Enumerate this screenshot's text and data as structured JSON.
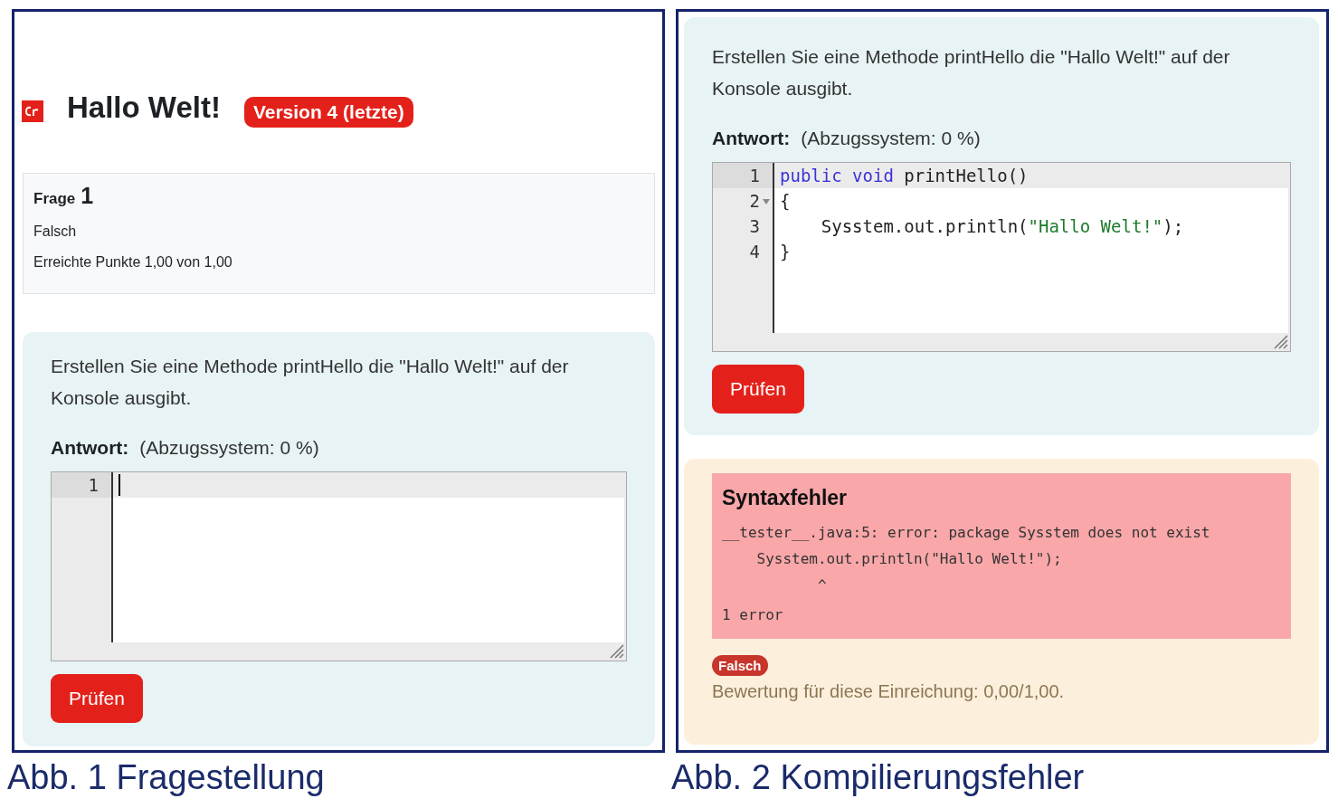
{
  "figure_1": {
    "header": {
      "title": "Hallo Welt!",
      "badge": "Version 4 (letzte)"
    },
    "info": {
      "label": "Frage",
      "number": "1",
      "status": "Falsch",
      "points": "Erreichte Punkte 1,00 von 1,00"
    },
    "question": {
      "text": "Erstellen Sie eine Methode printHello die \"Hallo Welt!\" auf der Konsole ausgibt.",
      "answer_label": "Antwort:",
      "answer_note": "(Abzugssystem: 0 %)",
      "editor": {
        "lines": [
          {
            "number": "1",
            "active": true,
            "foldable": false,
            "cursor": true
          }
        ]
      },
      "button": "Prüfen"
    },
    "caption": "Abb. 1 Fragestellung"
  },
  "figure_2": {
    "question": {
      "text": "Erstellen Sie eine Methode printHello die \"Hallo Welt!\" auf der Konsole ausgibt.",
      "answer_label": "Antwort:",
      "answer_note": "(Abzugssystem: 0 %)",
      "editor": {
        "lines": [
          {
            "number": "1",
            "active": true,
            "foldable": false,
            "cursor": false,
            "tokens": [
              {
                "kind": "keyword",
                "text": "public "
              },
              {
                "kind": "keyword",
                "text": "void"
              },
              {
                "kind": "plain",
                "text": " printHello()"
              }
            ]
          },
          {
            "number": "2",
            "active": false,
            "foldable": true,
            "cursor": false,
            "tokens": [
              {
                "kind": "plain",
                "text": "{"
              }
            ]
          },
          {
            "number": "3",
            "active": false,
            "foldable": false,
            "cursor": false,
            "tokens": [
              {
                "kind": "plain",
                "text": "    Sysstem.out.println("
              },
              {
                "kind": "string",
                "text": "\"Hallo Welt!\""
              },
              {
                "kind": "plain",
                "text": ");"
              }
            ]
          },
          {
            "number": "4",
            "active": false,
            "foldable": false,
            "cursor": false,
            "tokens": [
              {
                "kind": "plain",
                "text": "}"
              }
            ]
          }
        ]
      },
      "button": "Prüfen"
    },
    "feedback": {
      "title": "Syntaxfehler",
      "output": [
        "__tester__.java:5: error: package Sysstem does not exist",
        "    Sysstem.out.println(\"Hallo Welt!\");",
        "           ^",
        "1 error"
      ],
      "badge": "Falsch",
      "grade": "Bewertung für diese Einreichung: 0,00/1,00."
    },
    "caption": "Abb. 2 Kompilierungsfehler"
  }
}
